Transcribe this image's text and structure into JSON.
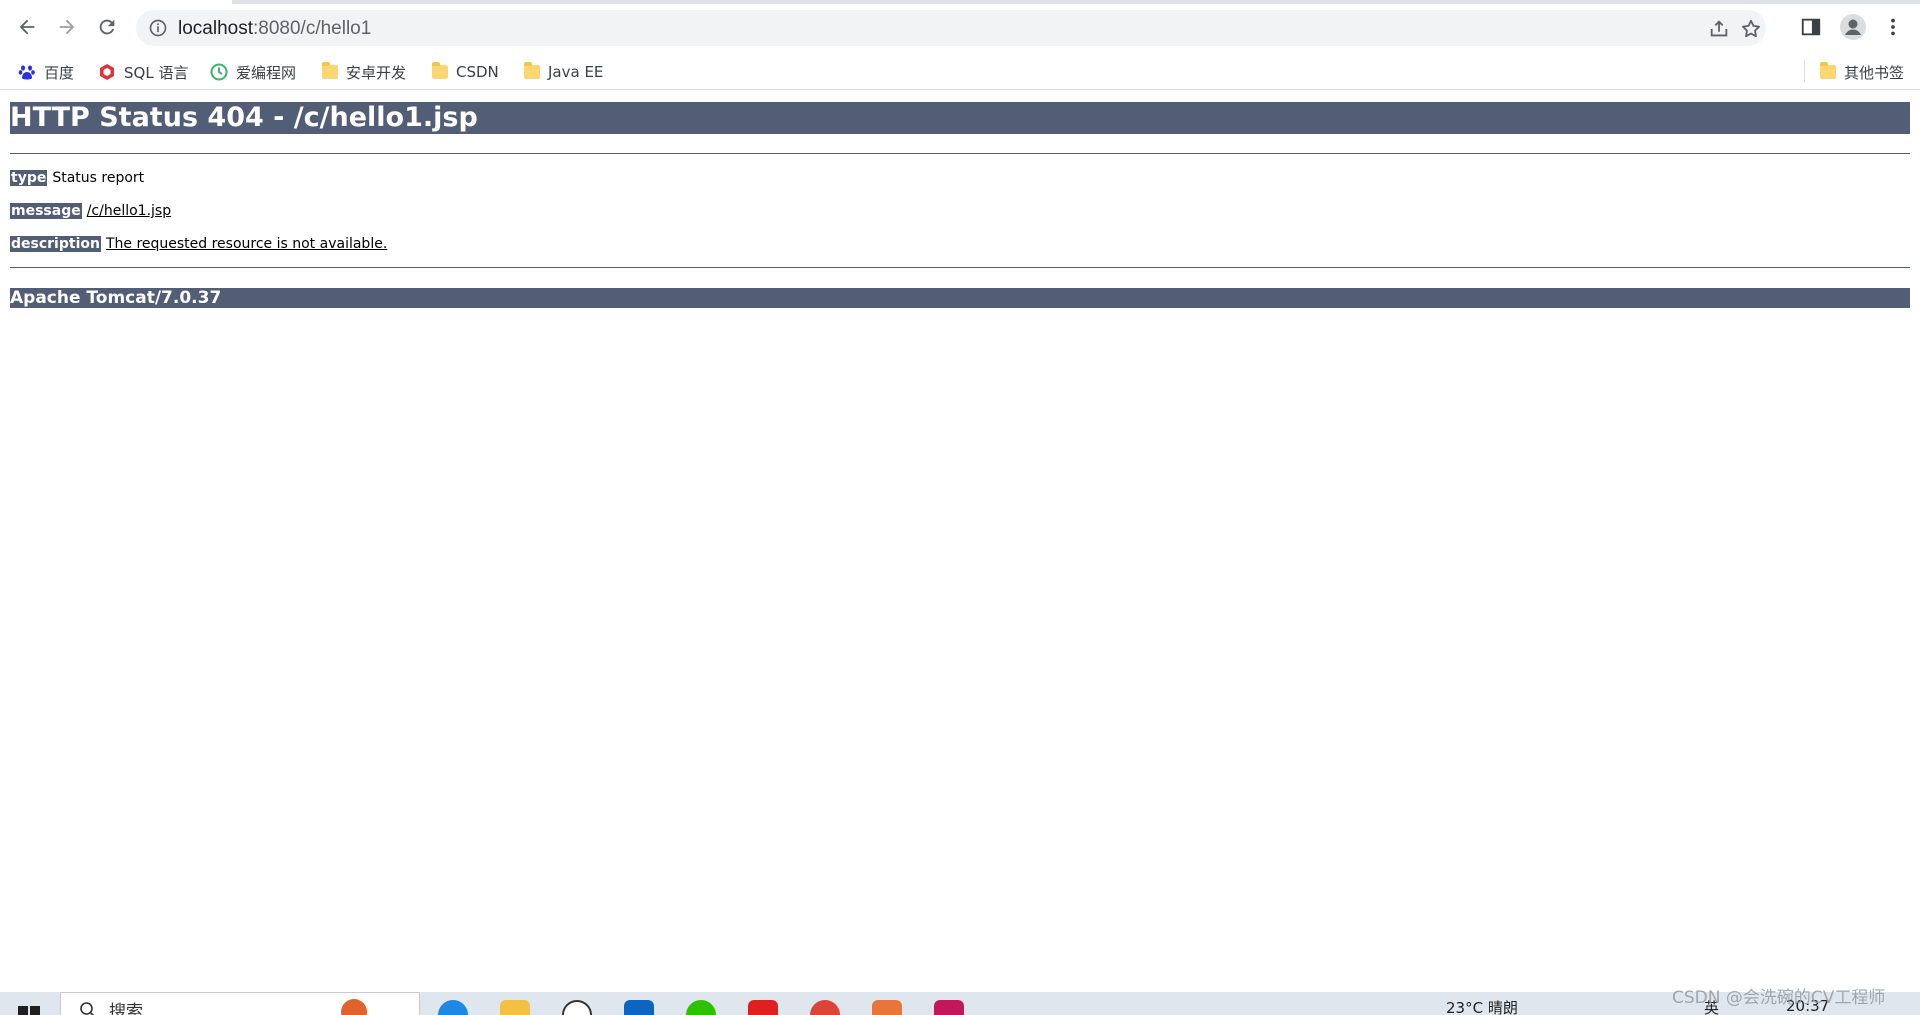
{
  "browser": {
    "url_host": "localhost",
    "url_rest": ":8080/c/hello1"
  },
  "bookmarks": [
    {
      "label": "百度",
      "icon": "baidu-paw-icon"
    },
    {
      "label": "SQL 语言",
      "icon": "sql-shield-icon"
    },
    {
      "label": "爱编程网",
      "icon": "clock-circle-icon"
    },
    {
      "label": "安卓开发",
      "icon": "folder-icon"
    },
    {
      "label": "CSDN",
      "icon": "folder-icon"
    },
    {
      "label": "Java EE",
      "icon": "folder-icon"
    }
  ],
  "other_bookmarks": "其他书签",
  "page": {
    "title": "HTTP Status 404 - /c/hello1.jsp",
    "type_label": "type",
    "type_value": "Status report",
    "message_label": "message",
    "message_value": "/c/hello1.jsp",
    "description_label": "description",
    "description_value": "The requested resource is not available.",
    "server": "Apache Tomcat/7.0.37"
  },
  "taskbar": {
    "search_placeholder": "搜索",
    "weather": "23°C 晴朗",
    "ime": "英",
    "time": "20:37"
  },
  "watermark": "CSDN @会洗碗的CV工程师",
  "colors": {
    "tomcat_header": "#525d76",
    "folder": "#fbd773"
  }
}
